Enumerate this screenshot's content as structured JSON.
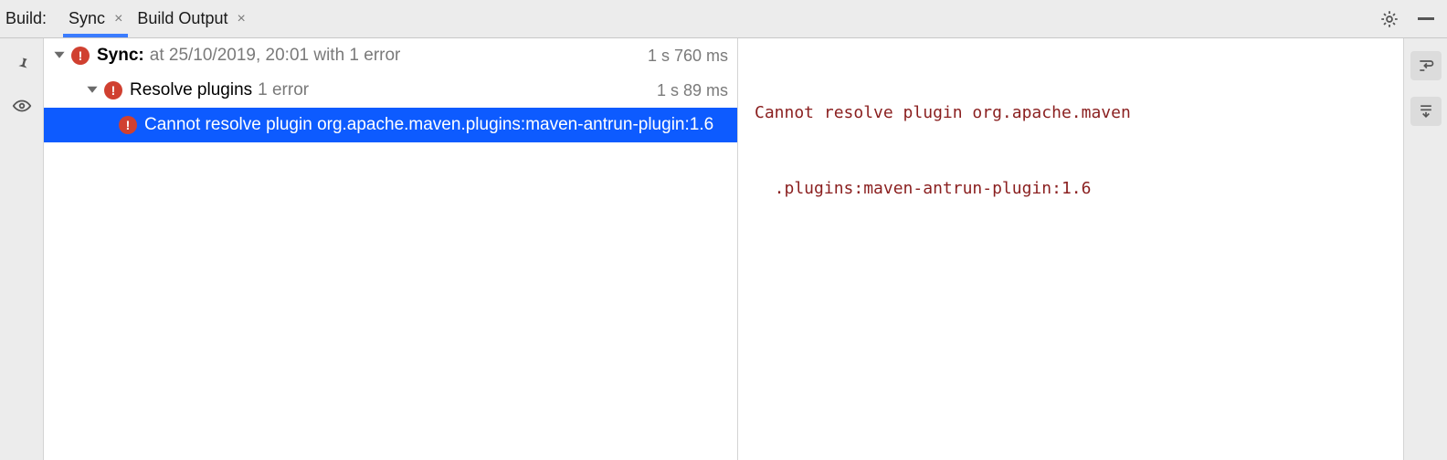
{
  "header": {
    "label": "Build:",
    "tabs": [
      {
        "label": "Sync",
        "active": true,
        "closable": true
      },
      {
        "label": "Build Output",
        "active": false,
        "closable": true
      }
    ]
  },
  "tree": {
    "root": {
      "title": "Sync:",
      "subtext": "at 25/10/2019, 20:01 with 1 error",
      "timing": "1 s 760 ms"
    },
    "child": {
      "title": "Resolve plugins",
      "subtext": "1 error",
      "timing": "1 s 89 ms"
    },
    "leaf": {
      "title": "Cannot resolve plugin org.apache.maven.plugins:maven-antrun-plugin:1.6"
    }
  },
  "detail": {
    "line1": "Cannot resolve plugin org.apache.maven",
    "line2": ".plugins:maven-antrun-plugin:1.6"
  },
  "icons": {
    "gear": "gear-icon",
    "minimize": "minimize-icon",
    "pin": "pin-icon",
    "eye": "eye-icon",
    "wrap": "soft-wrap-icon",
    "scroll": "scroll-to-end-icon"
  }
}
